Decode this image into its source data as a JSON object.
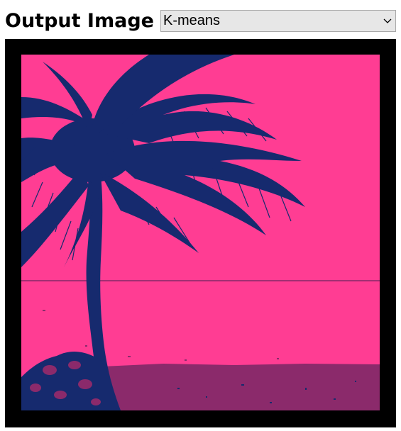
{
  "header": {
    "title": "Output Image"
  },
  "method_select": {
    "selected": "K-means",
    "icon": "chevron-down-icon"
  },
  "output_image": {
    "subject": "palm tree silhouette on beach, k-means quantized",
    "colors": {
      "sky": "#ff3d93",
      "tree": "#162a6e",
      "sand": "#8b2a6b",
      "frame": "#000000"
    }
  }
}
